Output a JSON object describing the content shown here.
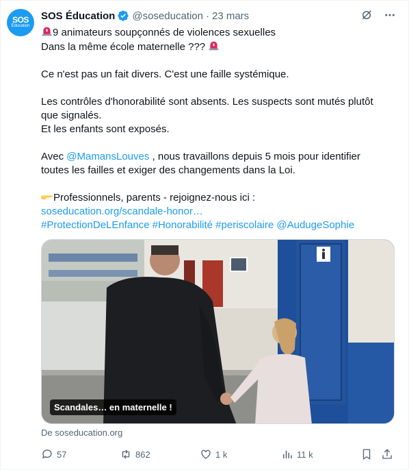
{
  "author": {
    "display_name": "SOS Éducation",
    "handle": "@soseducation",
    "separator": "·",
    "date": "23 mars",
    "avatar_text_top": "SOS",
    "avatar_text_bottom": "Éducation"
  },
  "body": {
    "line1": "9 animateurs soupçonnés de violences sexuelles",
    "line2": "Dans la même école maternelle ???",
    "para2": "Ce n'est pas un fait divers. C'est une faille systémique.",
    "para3_line1": "Les contrôles d'honorabilité sont absents. Les suspects sont mutés plutôt",
    "para3_line2": "que signalés.",
    "para3_line3": "Et les enfants sont exposés.",
    "para4_pre": "Avec ",
    "para4_mention": "@MamansLouves",
    "para4_post_line1": " , nous travaillons depuis 5 mois pour identifier",
    "para4_line2": "toutes les failles et exiger des changements dans la Loi.",
    "para5": "Professionnels, parents - rejoignez-nous ici :",
    "link": "soseducation.org/scandale-honor…",
    "hashtags": [
      "#ProtectionDeLEnfance",
      "#Honorabilité",
      "#periscolaire",
      "@AudugeSophie"
    ]
  },
  "media": {
    "caption": "Scandales… en maternelle !"
  },
  "source": "De soseducation.org",
  "actions": {
    "replies": "57",
    "retweets": "862",
    "likes": "1 k",
    "views": "11 k"
  },
  "colors": {
    "accent": "#1d9bf0",
    "text": "#0f1419",
    "muted": "#536471"
  }
}
